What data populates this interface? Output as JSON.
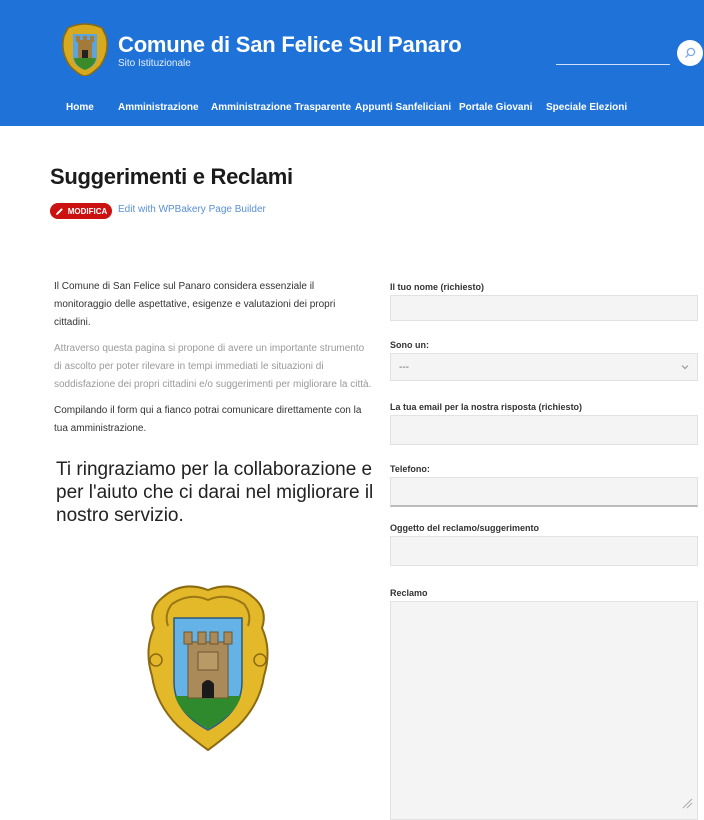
{
  "header": {
    "site_title": "Comune di San Felice Sul Panaro",
    "site_subtitle": "Sito Istituzionale",
    "colors": {
      "brand": "#1f73d8"
    },
    "nav": [
      "Home",
      "Amministrazione",
      "Amministrazione Trasparente",
      "Appunti Sanfeliciani",
      "Portale Giovani",
      "Speciale Elezioni"
    ]
  },
  "page": {
    "title": "Suggerimenti e Reclami",
    "edit_badge": "MODIFICA",
    "edit_link": "Edit with WPBakery Page Builder"
  },
  "intro": {
    "p1": "Il Comune di San Felice sul Panaro considera essenziale il monitoraggio delle aspettative, esigenze e valutazioni dei propri cittadini.",
    "p2": "Attraverso questa pagina si propone di avere un importante strumento di ascolto per poter rilevare in tempi immediati le situazioni di soddisfazione dei propri cittadini e/o suggerimenti per migliorare la città.",
    "p3": "Compilando il form qui a fianco potrai comunicare direttamente con la tua amministrazione.",
    "thanks": "Ti ringraziamo per la collaborazione e per l'aiuto che ci darai nel migliorare il nostro servizio."
  },
  "form": {
    "name_label": "Il tuo nome (richiesto)",
    "sono_label": "Sono un:",
    "sono_value": "---",
    "email_label": "La tua email per la nostra risposta (richiesto)",
    "phone_label": "Telefono:",
    "subject_label": "Oggetto del reclamo/suggerimento",
    "complaint_label": "Reclamo"
  },
  "icons": {
    "search": "search-icon",
    "edit": "pencil-icon",
    "logo": "coat-of-arms-icon",
    "select": "chevron-down-icon"
  }
}
